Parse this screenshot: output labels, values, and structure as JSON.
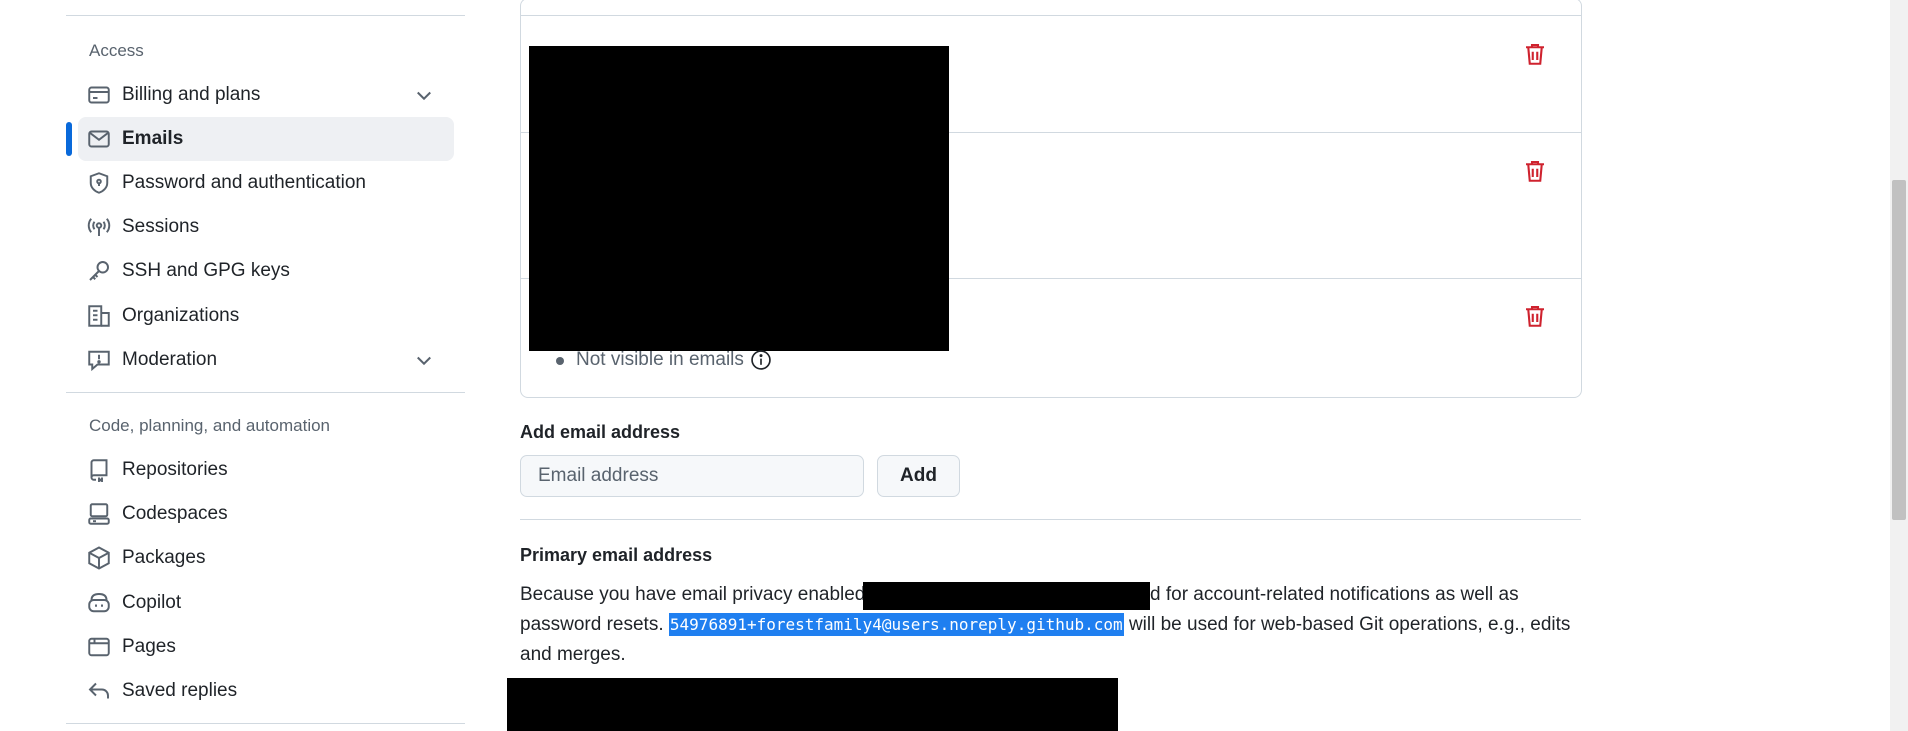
{
  "sidebar": {
    "sections": [
      {
        "heading": "Access",
        "items": [
          {
            "label": "Billing and plans",
            "icon": "credit-card-icon",
            "expandable": true
          },
          {
            "label": "Emails",
            "icon": "mail-icon",
            "active": true
          },
          {
            "label": "Password and authentication",
            "icon": "shield-lock-icon"
          },
          {
            "label": "Sessions",
            "icon": "broadcast-icon"
          },
          {
            "label": "SSH and GPG keys",
            "icon": "key-icon"
          },
          {
            "label": "Organizations",
            "icon": "organization-icon"
          },
          {
            "label": "Moderation",
            "icon": "report-icon",
            "expandable": true
          }
        ]
      },
      {
        "heading": "Code, planning, and automation",
        "items": [
          {
            "label": "Repositories",
            "icon": "repo-icon"
          },
          {
            "label": "Codespaces",
            "icon": "codespaces-icon"
          },
          {
            "label": "Packages",
            "icon": "package-icon"
          },
          {
            "label": "Copilot",
            "icon": "copilot-icon"
          },
          {
            "label": "Pages",
            "icon": "browser-icon"
          },
          {
            "label": "Saved replies",
            "icon": "reply-icon"
          }
        ]
      }
    ]
  },
  "emails": {
    "not_visible_text": "Not visible in emails",
    "delete_icon": "trash-icon"
  },
  "add_email": {
    "heading": "Add email address",
    "placeholder": "Email address",
    "button_label": "Add"
  },
  "primary_email": {
    "heading": "Primary email address",
    "line1_start": "Because you have email privacy enabled",
    "line1_end": "d for account-related notifications as well as",
    "line2_start": "password resets.",
    "noreply_address": "54976891+forestfamily4@users.noreply.github.com",
    "line2_end": "will be used for web-based Git operations, e.g., edits",
    "line3": "and merges."
  },
  "colors": {
    "accent": "#0969da",
    "danger": "#cf222e",
    "selection": "#1f7ff0"
  }
}
